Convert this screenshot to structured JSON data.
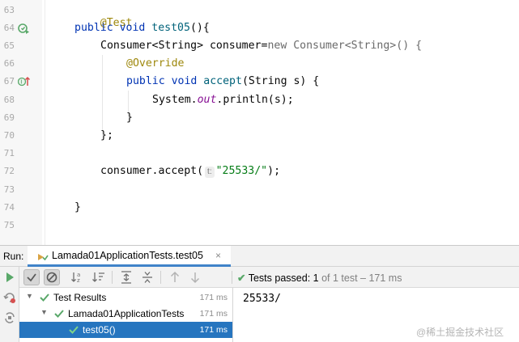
{
  "editor": {
    "lines": [
      {
        "num": "63"
      },
      {
        "num": "64"
      },
      {
        "num": "65"
      },
      {
        "num": "66"
      },
      {
        "num": "67"
      },
      {
        "num": "68"
      },
      {
        "num": "69"
      },
      {
        "num": "70"
      },
      {
        "num": "71"
      },
      {
        "num": "72"
      },
      {
        "num": "73"
      },
      {
        "num": "74"
      },
      {
        "num": "75"
      }
    ],
    "code": {
      "l63_annotation": "@Test",
      "l64_kw": "public void",
      "l64_method": "test05",
      "l64_rest": "(){",
      "l65_type": "Consumer<String> consumer=",
      "l65_kw_new": "new",
      "l65_rest": "Consumer<String>() {",
      "l66_annotation": "@Override",
      "l67_kw": "public void",
      "l67_method": "accept",
      "l67_rest": "(String s) {",
      "l68_system": "System.",
      "l68_field": "out",
      "l68_rest": ".println(s);",
      "l69_brace": "}",
      "l70_close": "};",
      "l72_call": "consumer.accept(",
      "l72_hint": "t:",
      "l72_string": "\"25533/\"",
      "l72_end": ");",
      "l74_brace": "}"
    }
  },
  "run_panel": {
    "label": "Run:",
    "tab_title": "Lamada01ApplicationTests.test05",
    "tab_close": "×",
    "status_prefix": "Tests passed:",
    "status_count": "1",
    "status_suffix": "of 1 test – 171 ms",
    "tree": [
      {
        "name": "Test Results",
        "time": "171 ms"
      },
      {
        "name": "Lamada01ApplicationTests",
        "time": "171 ms"
      },
      {
        "name": "test05()",
        "time": "171 ms"
      }
    ],
    "console_output": "25533/",
    "watermark": "@稀土掘金技术社区"
  },
  "colors": {
    "accent": "#2675bf",
    "success": "#59a869",
    "keyword": "#0033b3",
    "annotation": "#9e880d",
    "string": "#067d17"
  }
}
